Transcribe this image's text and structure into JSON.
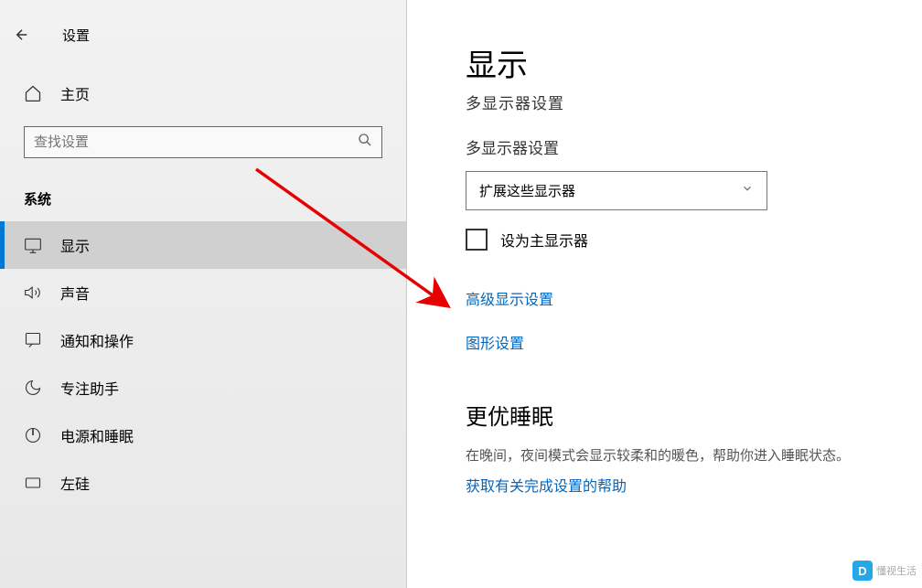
{
  "header": {
    "title": "设置"
  },
  "home": {
    "label": "主页"
  },
  "search": {
    "placeholder": "查找设置"
  },
  "section": {
    "title": "系统"
  },
  "nav": {
    "display": "显示",
    "sound": "声音",
    "notifications": "通知和操作",
    "focus": "专注助手",
    "power": "电源和睡眠",
    "storage": "左硅"
  },
  "main": {
    "title": "显示",
    "subtitle": "多显示器设置",
    "multiLabel": "多显示器设置",
    "dropdownSelected": "扩展这些显示器",
    "checkboxLabel": "设为主显示器",
    "advancedLink": "高级显示设置",
    "graphicsLink": "图形设置",
    "sleepTitle": "更优睡眠",
    "sleepDesc": "在晚间，夜间模式会显示较柔和的暖色，帮助你进入睡眠状态。",
    "sleepLink": "获取有关完成设置的帮助"
  },
  "watermark": {
    "text": "懂视生活"
  }
}
